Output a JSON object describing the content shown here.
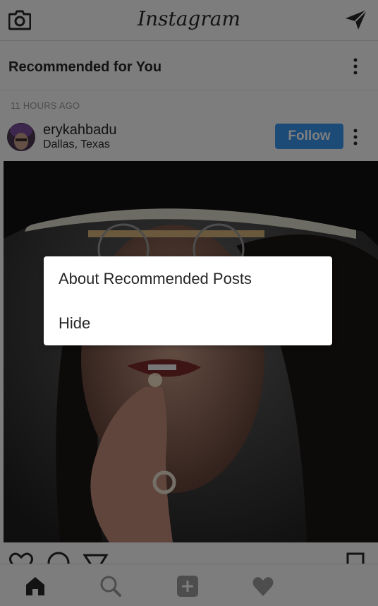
{
  "app": {
    "title": "Instagram",
    "icons": {
      "camera": "camera-icon",
      "direct": "direct-message-icon"
    }
  },
  "recommended": {
    "title": "Recommended for You",
    "more_icon": "more-vertical-icon"
  },
  "post": {
    "timestamp": "11 HOURS AGO",
    "username": "erykahbadu",
    "location": "Dallas, Texas",
    "follow_label": "Follow",
    "more_icon": "more-vertical-icon",
    "actions": [
      "like-icon",
      "comment-icon",
      "share-icon",
      "save-icon"
    ]
  },
  "bottom_nav": [
    "home-icon",
    "search-icon",
    "add-post-icon",
    "activity-heart-icon"
  ],
  "menu": {
    "items": [
      {
        "label": "About Recommended Posts"
      },
      {
        "label": "Hide"
      }
    ]
  },
  "colors": {
    "follow_button": "#3897f0",
    "overlay": "rgba(0,0,0,0.5)",
    "menu_background": "#ffffff",
    "background": "#fafafa"
  }
}
